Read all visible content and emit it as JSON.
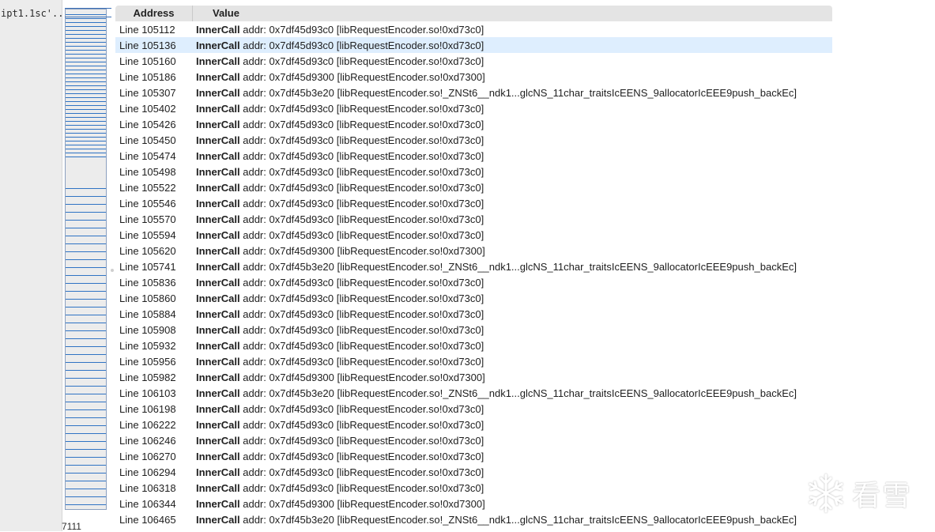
{
  "left_panel": {
    "script_label": "ipt1.1sc'..",
    "bottom_count": "7111"
  },
  "colors": {
    "selected_row": "#deeefe",
    "minimap_tick": "#2f73c4",
    "header_bg": "#e4e4e4"
  },
  "table": {
    "columns": [
      "Address",
      "Value"
    ],
    "selected_row_index": 1,
    "rows": [
      {
        "address": "Line 105112",
        "keyword": "InnerCall",
        "value": " addr: 0x7df45d93c0 [libRequestEncoder.so!0xd73c0]"
      },
      {
        "address": "Line 105136",
        "keyword": "InnerCall",
        "value": " addr: 0x7df45d93c0 [libRequestEncoder.so!0xd73c0]"
      },
      {
        "address": "Line 105160",
        "keyword": "InnerCall",
        "value": " addr: 0x7df45d93c0 [libRequestEncoder.so!0xd73c0]"
      },
      {
        "address": "Line 105186",
        "keyword": "InnerCall",
        "value": " addr: 0x7df45d9300 [libRequestEncoder.so!0xd7300]"
      },
      {
        "address": "Line 105307",
        "keyword": "InnerCall",
        "value": " addr: 0x7df45b3e20 [libRequestEncoder.so!_ZNSt6__ndk1...glcNS_11char_traitsIcEENS_9allocatorIcEEE9push_backEc]"
      },
      {
        "address": "Line 105402",
        "keyword": "InnerCall",
        "value": " addr: 0x7df45d93c0 [libRequestEncoder.so!0xd73c0]"
      },
      {
        "address": "Line 105426",
        "keyword": "InnerCall",
        "value": " addr: 0x7df45d93c0 [libRequestEncoder.so!0xd73c0]"
      },
      {
        "address": "Line 105450",
        "keyword": "InnerCall",
        "value": " addr: 0x7df45d93c0 [libRequestEncoder.so!0xd73c0]"
      },
      {
        "address": "Line 105474",
        "keyword": "InnerCall",
        "value": " addr: 0x7df45d93c0 [libRequestEncoder.so!0xd73c0]"
      },
      {
        "address": "Line 105498",
        "keyword": "InnerCall",
        "value": " addr: 0x7df45d93c0 [libRequestEncoder.so!0xd73c0]"
      },
      {
        "address": "Line 105522",
        "keyword": "InnerCall",
        "value": " addr: 0x7df45d93c0 [libRequestEncoder.so!0xd73c0]"
      },
      {
        "address": "Line 105546",
        "keyword": "InnerCall",
        "value": " addr: 0x7df45d93c0 [libRequestEncoder.so!0xd73c0]"
      },
      {
        "address": "Line 105570",
        "keyword": "InnerCall",
        "value": " addr: 0x7df45d93c0 [libRequestEncoder.so!0xd73c0]"
      },
      {
        "address": "Line 105594",
        "keyword": "InnerCall",
        "value": " addr: 0x7df45d93c0 [libRequestEncoder.so!0xd73c0]"
      },
      {
        "address": "Line 105620",
        "keyword": "InnerCall",
        "value": " addr: 0x7df45d9300 [libRequestEncoder.so!0xd7300]"
      },
      {
        "address": "Line 105741",
        "keyword": "InnerCall",
        "value": " addr: 0x7df45b3e20 [libRequestEncoder.so!_ZNSt6__ndk1...glcNS_11char_traitsIcEENS_9allocatorIcEEE9push_backEc]"
      },
      {
        "address": "Line 105836",
        "keyword": "InnerCall",
        "value": " addr: 0x7df45d93c0 [libRequestEncoder.so!0xd73c0]"
      },
      {
        "address": "Line 105860",
        "keyword": "InnerCall",
        "value": " addr: 0x7df45d93c0 [libRequestEncoder.so!0xd73c0]"
      },
      {
        "address": "Line 105884",
        "keyword": "InnerCall",
        "value": " addr: 0x7df45d93c0 [libRequestEncoder.so!0xd73c0]"
      },
      {
        "address": "Line 105908",
        "keyword": "InnerCall",
        "value": " addr: 0x7df45d93c0 [libRequestEncoder.so!0xd73c0]"
      },
      {
        "address": "Line 105932",
        "keyword": "InnerCall",
        "value": " addr: 0x7df45d93c0 [libRequestEncoder.so!0xd73c0]"
      },
      {
        "address": "Line 105956",
        "keyword": "InnerCall",
        "value": " addr: 0x7df45d93c0 [libRequestEncoder.so!0xd73c0]"
      },
      {
        "address": "Line 105982",
        "keyword": "InnerCall",
        "value": " addr: 0x7df45d9300 [libRequestEncoder.so!0xd7300]"
      },
      {
        "address": "Line 106103",
        "keyword": "InnerCall",
        "value": " addr: 0x7df45b3e20 [libRequestEncoder.so!_ZNSt6__ndk1...glcNS_11char_traitsIcEENS_9allocatorIcEEE9push_backEc]"
      },
      {
        "address": "Line 106198",
        "keyword": "InnerCall",
        "value": " addr: 0x7df45d93c0 [libRequestEncoder.so!0xd73c0]"
      },
      {
        "address": "Line 106222",
        "keyword": "InnerCall",
        "value": " addr: 0x7df45d93c0 [libRequestEncoder.so!0xd73c0]"
      },
      {
        "address": "Line 106246",
        "keyword": "InnerCall",
        "value": " addr: 0x7df45d93c0 [libRequestEncoder.so!0xd73c0]"
      },
      {
        "address": "Line 106270",
        "keyword": "InnerCall",
        "value": " addr: 0x7df45d93c0 [libRequestEncoder.so!0xd73c0]"
      },
      {
        "address": "Line 106294",
        "keyword": "InnerCall",
        "value": " addr: 0x7df45d93c0 [libRequestEncoder.so!0xd73c0]"
      },
      {
        "address": "Line 106318",
        "keyword": "InnerCall",
        "value": " addr: 0x7df45d93c0 [libRequestEncoder.so!0xd73c0]"
      },
      {
        "address": "Line 106344",
        "keyword": "InnerCall",
        "value": " addr: 0x7df45d9300 [libRequestEncoder.so!0xd7300]"
      },
      {
        "address": "Line 106465",
        "keyword": "InnerCall",
        "value": " addr: 0x7df45b3e20 [libRequestEncoder.so!_ZNSt6__ndk1...glcNS_11char_traitsIcEENS_9allocatorIcEEE9push_backEc]"
      }
    ]
  },
  "watermark": {
    "icon": "snowflake-logo-icon",
    "text": "看雪"
  }
}
